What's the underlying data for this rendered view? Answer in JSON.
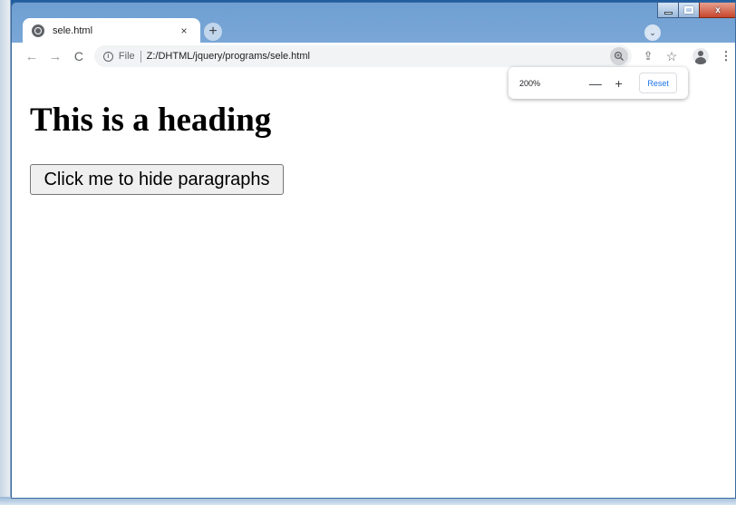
{
  "tab": {
    "title": "sele.html",
    "close_glyph": "×",
    "favicon": "globe-icon"
  },
  "newtab": {
    "glyph": "+"
  },
  "tabsearch": {
    "glyph": "⌄"
  },
  "toolbar": {
    "back_glyph": "←",
    "forward_glyph": "→",
    "reload_glyph": "C",
    "security_icon": "info-icon",
    "security_label": "File",
    "url": "Z:/DHTML/jquery/programs/sele.html",
    "star_glyph": "☆",
    "share_glyph": "⇪",
    "menu_glyph": "⋮"
  },
  "page": {
    "heading": "This is a heading",
    "button_label": "Click me to hide paragraphs"
  },
  "zoom_popup": {
    "level": "200%",
    "minus_glyph": "—",
    "plus_glyph": "+",
    "reset_label": "Reset"
  },
  "colors": {
    "accent": "#1a73e8",
    "frame": "#a9c8e8",
    "close_button": "#c8462c"
  }
}
